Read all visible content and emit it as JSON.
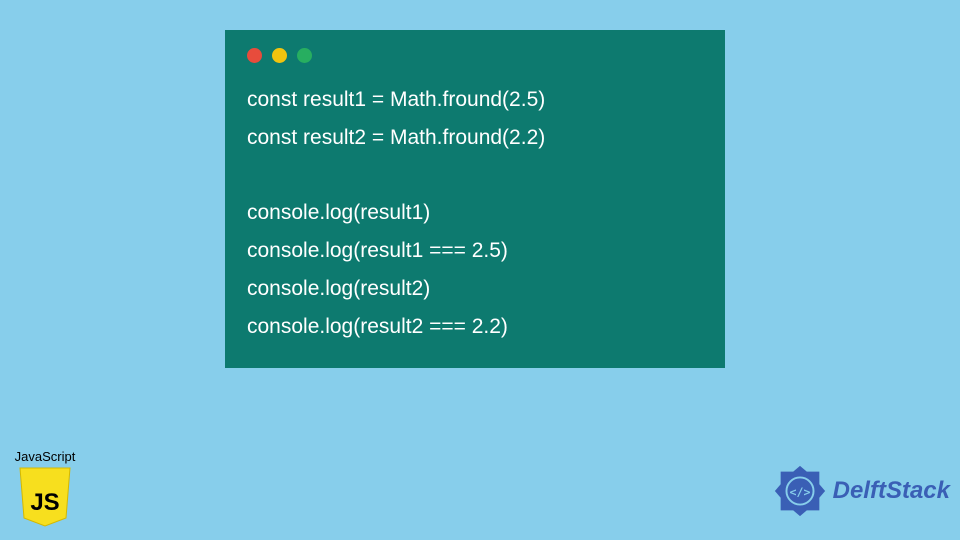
{
  "code_window": {
    "lines": [
      "const result1 = Math.fround(2.5)",
      "const result2 = Math.fround(2.2)",
      "",
      "console.log(result1)",
      "console.log(result1 === 2.5)",
      "console.log(result2)",
      "console.log(result2 === 2.2)"
    ],
    "traffic_colors": {
      "red": "#e74c3c",
      "yellow": "#f1c40f",
      "green": "#27ae60"
    }
  },
  "js_badge": {
    "label": "JavaScript",
    "logo_text": "JS"
  },
  "delft_badge": {
    "text": "DelftStack"
  }
}
